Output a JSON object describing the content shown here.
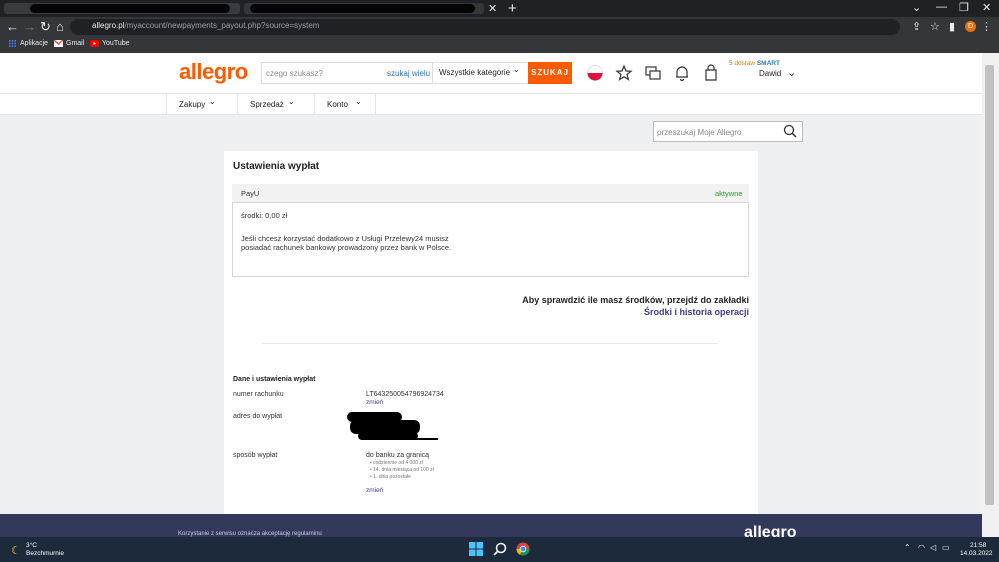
{
  "browser": {
    "url_host": "allegro.pl",
    "url_path": "/myaccount/newpayments_payout.php?source=system",
    "profile_initial": "D",
    "bookmarks": [
      {
        "label": "Aplikacje",
        "icon": "apps-grid-icon"
      },
      {
        "label": "Gmail",
        "icon": "gmail-icon"
      },
      {
        "label": "YouTube",
        "icon": "youtube-icon"
      }
    ]
  },
  "header": {
    "logo": "allegro",
    "search_placeholder": "czego szukasz?",
    "search_many": "szukaj wielu",
    "category": "Wszystkie kategorie",
    "search_button": "SZUKAJ",
    "smart_prefix": "5 dostaw",
    "smart_label": "SMART",
    "user_name": "Dawid"
  },
  "subnav": {
    "items": [
      "Zakupy",
      "Sprzedaż",
      "Konto"
    ]
  },
  "myallegro_search_placeholder": "przeszukaj Moje Allegro",
  "content": {
    "title": "Ustawienia wypłat",
    "provider": {
      "name": "PayU",
      "status": "aktywne",
      "balance": "środki: 0,00 zł",
      "info": "Jeśli chcesz korzystać dodatkowo z Usługi Przelewy24 musisz posiadać rachunek bankowy prowadzony przez bank w Polsce."
    },
    "check_text": "Aby sprawdzić ile masz środków, przejdź do zakładki",
    "check_link": "Środki i historia operacji",
    "payout": {
      "section_title": "Dane i ustawienia wypłat",
      "account_label": "numer rachunku",
      "account_value": "LT643250054796924734",
      "change_link": "zmień",
      "address_label": "adres do wypłat",
      "method_label": "sposób wypłat",
      "method_value": "do banku za granicą",
      "method_bullets": [
        "codziennie od 4 000 zł",
        "14. dnia miesiąca od 100 zł",
        "1. dnia pozostałe"
      ],
      "method_change_link": "zmień"
    }
  },
  "footer": {
    "logo": "allegro",
    "text": "Korzystanie z serwisu oznacza akceptację regulaminu"
  },
  "taskbar": {
    "temperature": "3°C",
    "weather": "Bezchmurnie",
    "time": "21:58",
    "date": "14.03.2022"
  },
  "colors": {
    "brand": "#ff5a00",
    "link": "#3f3a8a",
    "active": "#2d9b2d",
    "footer": "#33395a"
  }
}
